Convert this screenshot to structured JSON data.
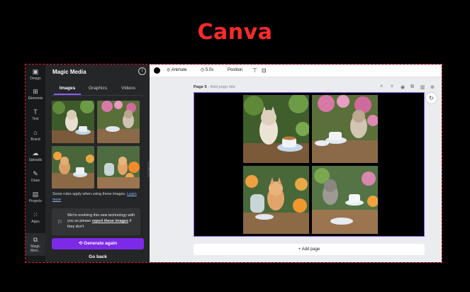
{
  "banner": {
    "title": "Canva"
  },
  "rail": {
    "items": [
      {
        "label": "Design",
        "icon": "design-icon"
      },
      {
        "label": "Elements",
        "icon": "elements-icon"
      },
      {
        "label": "Text",
        "icon": "text-icon"
      },
      {
        "label": "Brand",
        "icon": "brand-icon"
      },
      {
        "label": "Uploads",
        "icon": "uploads-icon"
      },
      {
        "label": "Draw",
        "icon": "draw-icon"
      },
      {
        "label": "Projects",
        "icon": "projects-icon"
      },
      {
        "label": "Apps",
        "icon": "apps-icon"
      },
      {
        "label": "Magic Med...",
        "icon": "magic-media-icon"
      }
    ]
  },
  "panel": {
    "title": "Magic Media",
    "tabs": [
      {
        "label": "Images"
      },
      {
        "label": "Graphics"
      },
      {
        "label": "Videos"
      }
    ],
    "active_tab": "Images",
    "rules_text": "Some rules apply when using these images.",
    "rules_link": "Learn more",
    "notice_text_1": "We're evolving this new technology with you so please",
    "notice_link": "report these images",
    "notice_text_2": "if they don't",
    "generate_label": "Generate again",
    "back_label": "Go back"
  },
  "toolbar": {
    "animate_label": "Animate",
    "duration_label": "5.0s",
    "position_label": "Position"
  },
  "editor": {
    "page_label": "Page 5",
    "page_title_placeholder": "- Add page title",
    "add_page_label": "+ Add page"
  },
  "colors": {
    "accent": "#8b5cf6",
    "generate_button": "#7d2ae8",
    "banner": "#ff2a2a",
    "panel_bg": "#252627",
    "rail_bg": "#18191b",
    "editor_bg": "#ebecf0"
  }
}
